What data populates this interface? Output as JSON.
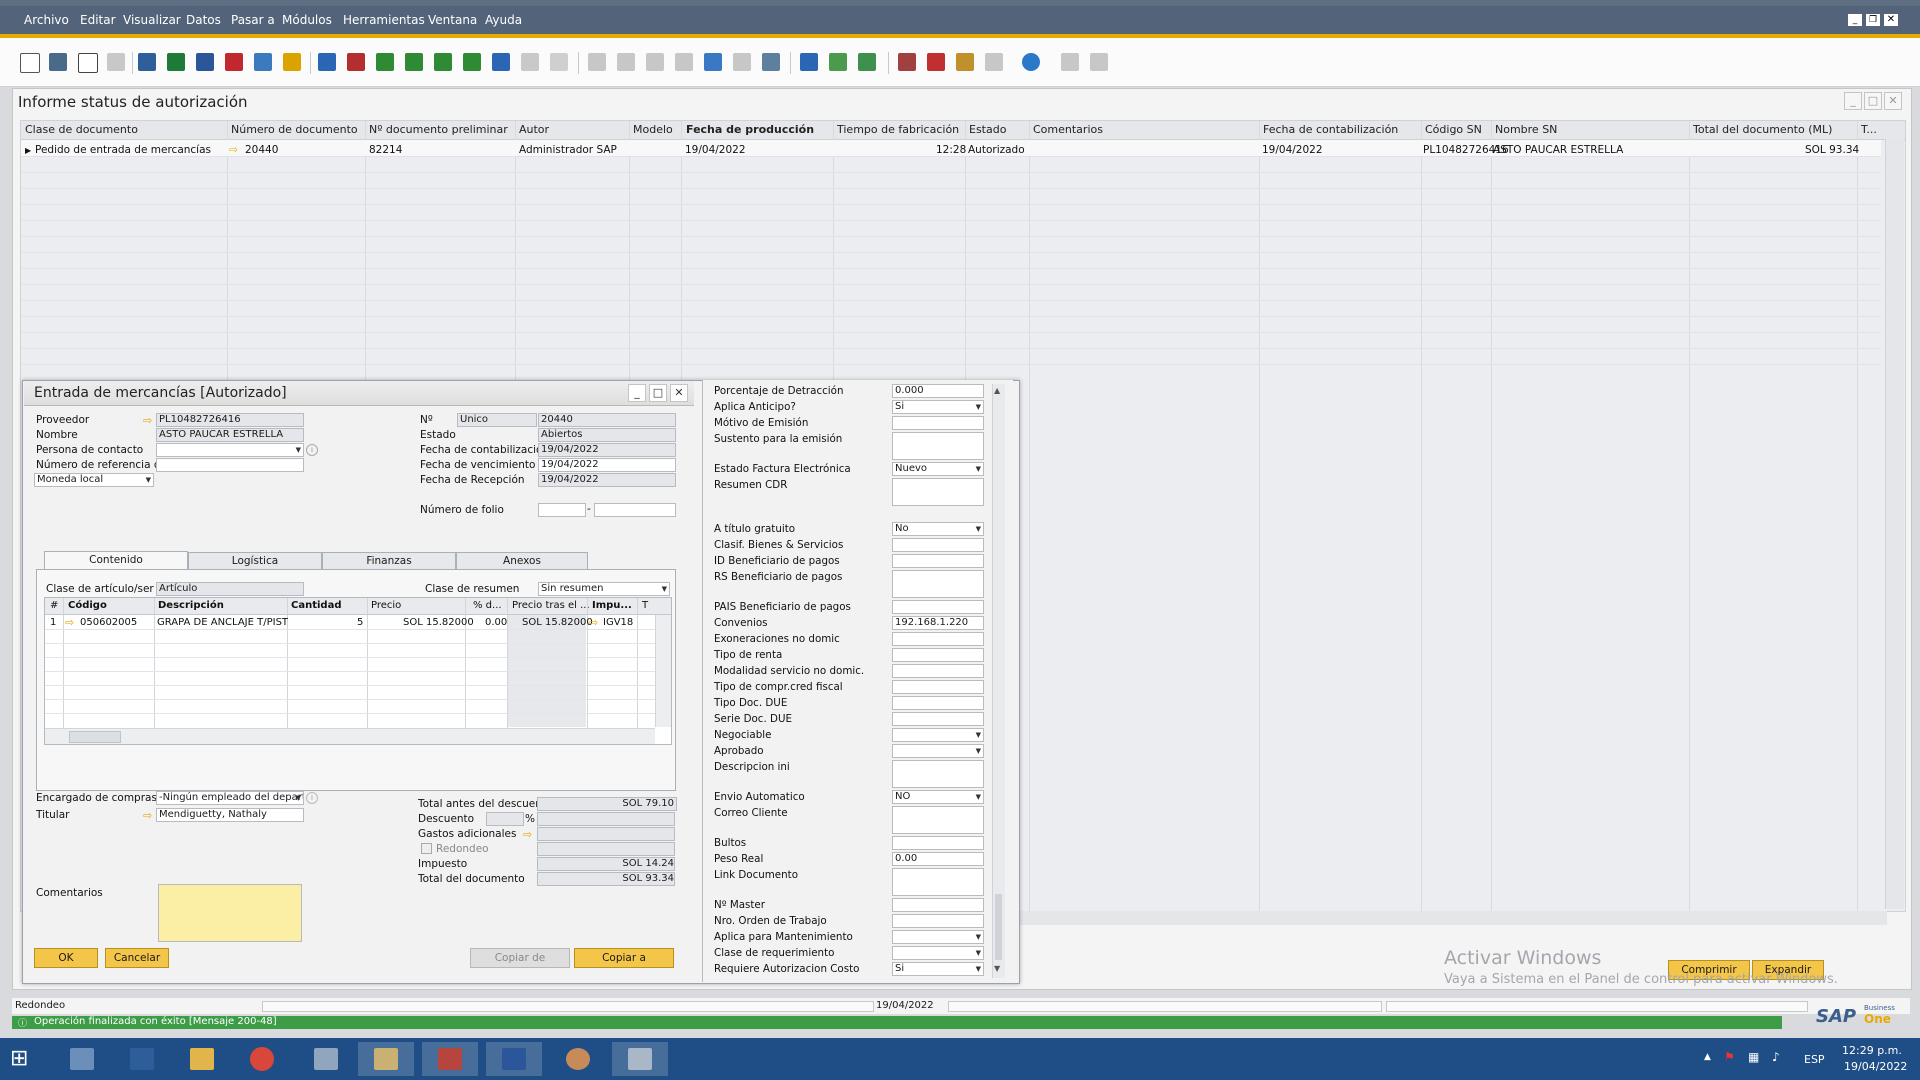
{
  "menu": [
    "Archivo",
    "Editar",
    "Visualizar",
    "Datos",
    "Pasar a",
    "Módulos",
    "Herramientas",
    "Ventana",
    "Ayuda"
  ],
  "window_title": "Informe status de autorización",
  "grid": {
    "headers": [
      "Clase de documento",
      "Número de documento",
      "Nº documento preliminar",
      "Autor",
      "Modelo",
      "Fecha de producción",
      "Tiempo de fabricación",
      "Estado",
      "Comentarios",
      "Fecha de contabilización",
      "Código SN",
      "Nombre SN",
      "Total del documento (ML)",
      "T..."
    ],
    "row": {
      "clase": "Pedido de entrada de mercancías",
      "numero": "20440",
      "preliminar": "82214",
      "autor": "Administrador SAP",
      "fecha_prod": "19/04/2022",
      "tiempo": "12:28",
      "estado": "Autorizado",
      "fecha_cont": "19/04/2022",
      "codigo_sn": "PL10482726416",
      "nombre_sn": "ASTO PAUCAR ESTRELLA",
      "total": "SOL 93.34"
    }
  },
  "child": {
    "title": "Entrada de mercancías [Autorizado]",
    "proveedor_label": "Proveedor",
    "proveedor": "PL10482726416",
    "nombre_label": "Nombre",
    "nombre": "ASTO PAUCAR ESTRELLA",
    "contacto_label": "Persona de contacto",
    "referencia_label": "Número de referencia d",
    "moneda": "Moneda local",
    "no_label": "Nº",
    "serie": "Unico",
    "numero": "20440",
    "estado_label": "Estado",
    "estado": "Abiertos",
    "fcont_label": "Fecha de contabilización",
    "fcont": "19/04/2022",
    "fvenc_label": "Fecha de vencimiento",
    "fvenc": "19/04/2022",
    "frec_label": "Fecha de Recepción",
    "frec": "19/04/2022",
    "folio_label": "Número de folio",
    "folio_sep": "-",
    "tabs": [
      "Contenido",
      "Logística",
      "Finanzas",
      "Anexos"
    ],
    "clase_art_label": "Clase de artículo/ser",
    "clase_art": "Artículo",
    "clase_res_label": "Clase de resumen",
    "clase_res": "Sin resumen",
    "table_headers": [
      "#",
      "Código",
      "Descripción",
      "Cantidad",
      "Precio",
      "% d...",
      "Precio tras el ...",
      "Impu...",
      "T"
    ],
    "line": {
      "n": "1",
      "codigo": "050602005",
      "descripcion": "GRAPA DE ANCLAJE T/PIST",
      "cantidad": "5",
      "precio": "SOL 15.82000",
      "desc": "0.00",
      "precio_tras": "SOL 15.82000",
      "impuesto": "IGV18"
    },
    "encargado_label": "Encargado de compras",
    "encargado": "-Ningún empleado del depart",
    "titular_label": "Titular",
    "titular": "Mendiguetty, Nathaly",
    "total_antes_label": "Total antes del descuento",
    "total_antes": "SOL 79.10",
    "descuento_label": "Descuento",
    "pct": "%",
    "gastos_label": "Gastos adicionales",
    "redondeo_label": "Redondeo",
    "impuesto_label": "Impuesto",
    "impuesto": "SOL 14.24",
    "total_doc_label": "Total del documento",
    "total_doc": "SOL 93.34",
    "comentarios_label": "Comentarios",
    "ok": "OK",
    "cancelar": "Cancelar",
    "copiar_de": "Copiar de",
    "copiar_a": "Copiar a"
  },
  "udf": [
    {
      "label": "Porcentaje de Detracción",
      "value": "0.000"
    },
    {
      "label": "Aplica Anticipo?",
      "value": "Si",
      "sel": true
    },
    {
      "label": "Mótivo de Emisión",
      "value": ""
    },
    {
      "label": "Sustento para la emisión",
      "value": "",
      "tall": true
    },
    {
      "label": "Estado Factura Electrónica",
      "value": "Nuevo",
      "sel": true
    },
    {
      "label": "Resumen CDR",
      "value": "",
      "tall": true
    },
    {
      "label": "A título gratuito",
      "value": "No",
      "sel": true
    },
    {
      "label": "Clasif. Bienes & Servicios",
      "value": ""
    },
    {
      "label": "ID Beneficiario de pagos",
      "value": ""
    },
    {
      "label": "RS Beneficiario de pagos",
      "value": "",
      "tall": true
    },
    {
      "label": "PAIS Beneficiario de pagos",
      "value": ""
    },
    {
      "label": "Convenios",
      "value": "192.168.1.220"
    },
    {
      "label": "Exoneraciones no domic",
      "value": ""
    },
    {
      "label": "Tipo de renta",
      "value": ""
    },
    {
      "label": "Modalidad servicio no domic.",
      "value": ""
    },
    {
      "label": "Tipo de compr.cred fiscal",
      "value": ""
    },
    {
      "label": "Tipo Doc. DUE",
      "value": ""
    },
    {
      "label": "Serie Doc. DUE",
      "value": ""
    },
    {
      "label": "Negociable",
      "value": "",
      "sel": true
    },
    {
      "label": "Aprobado",
      "value": "",
      "sel": true
    },
    {
      "label": "Descripcion ini",
      "value": "",
      "tall": true
    },
    {
      "label": "Envio Automatico",
      "value": "NO",
      "sel": true
    },
    {
      "label": "Correo Cliente",
      "value": "",
      "tall": true
    },
    {
      "label": "Bultos",
      "value": ""
    },
    {
      "label": "Peso Real",
      "value": "0.00"
    },
    {
      "label": "Link Documento",
      "value": "",
      "tall": true
    },
    {
      "label": "Nº Master",
      "value": ""
    },
    {
      "label": "Nro. Orden de Trabajo",
      "value": ""
    },
    {
      "label": "Aplica para Mantenimiento",
      "value": "",
      "sel": true
    },
    {
      "label": "Clase de requerimiento",
      "value": "",
      "sel": true
    },
    {
      "label": "Requiere Autorizacion Costo",
      "value": "Si",
      "sel": true
    }
  ],
  "actions": {
    "comprimir": "Comprimir",
    "expandir": "Expandir"
  },
  "watermark": {
    "line1": "Activar Windows",
    "line2": "Vaya a Sistema en el Panel de control para activar Windows."
  },
  "status": {
    "left": "Redondeo",
    "date": "19/04/2022",
    "message": "Operación finalizada con éxito  [Mensaje 200-48]"
  },
  "brand": {
    "sap": "SAP",
    "business": "Business",
    "one": "One"
  },
  "tray": {
    "lang": "ESP",
    "time": "12:29 p.m.",
    "date": "19/04/2022"
  },
  "colors": {
    "menubar": "#53647a",
    "accent": "#e8a900",
    "status_ok": "#3d9d47",
    "taskbar": "#1f4d85"
  }
}
